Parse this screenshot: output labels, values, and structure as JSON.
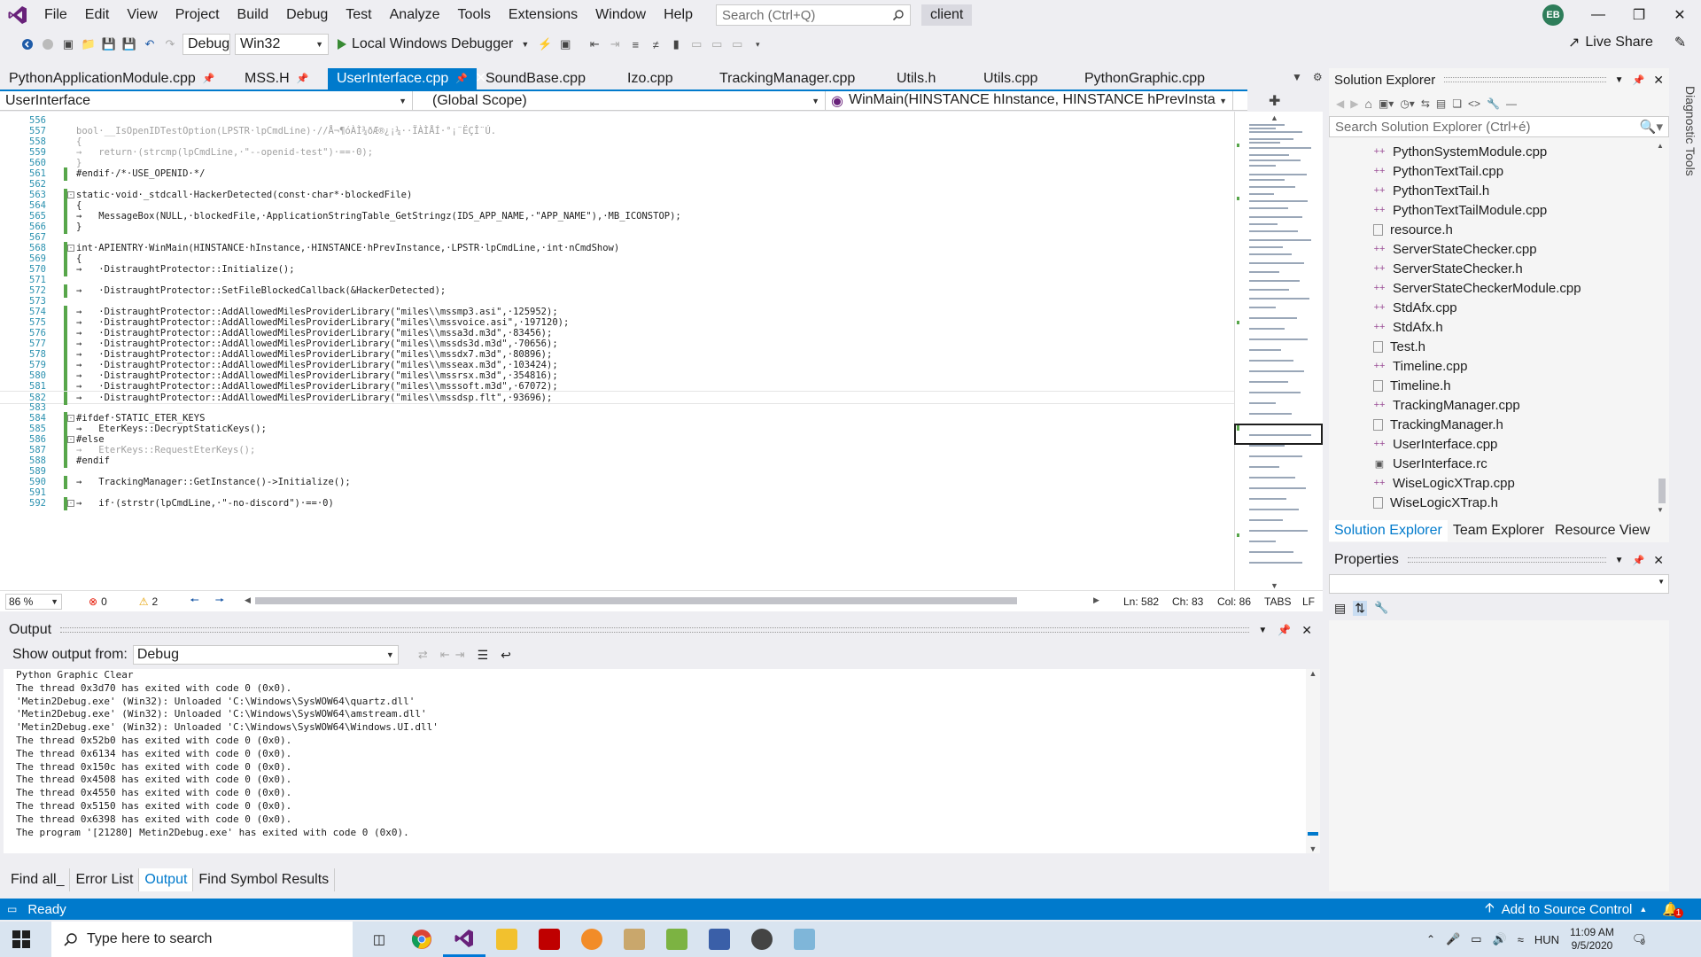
{
  "menubar": {
    "items": [
      "File",
      "Edit",
      "View",
      "Project",
      "Build",
      "Debug",
      "Test",
      "Analyze",
      "Tools",
      "Extensions",
      "Window",
      "Help"
    ],
    "search_placeholder": "Search (Ctrl+Q)",
    "solution": "client",
    "avatar_initials": "EB"
  },
  "toolbar": {
    "config": "Debug",
    "platform": "Win32",
    "debugger": "Local Windows Debugger",
    "live_share": "Live Share"
  },
  "doc_tabs": [
    {
      "label": "PythonApplicationModule.cpp",
      "pinned": true
    },
    {
      "label": "MSS.H",
      "pinned": true
    },
    {
      "label": "UserInterface.cpp",
      "pinned": true,
      "active": true
    },
    {
      "label": "SoundBase.cpp"
    },
    {
      "label": "Izo.cpp"
    },
    {
      "label": "TrackingManager.cpp"
    },
    {
      "label": "Utils.h"
    },
    {
      "label": "Utils.cpp"
    },
    {
      "label": "PythonGraphic.cpp"
    }
  ],
  "navbar": {
    "project": "UserInterface",
    "scope": "(Global Scope)",
    "member": "WinMain(HINSTANCE hInstance, HINSTANCE hPrevInstance, LPST"
  },
  "editor": {
    "lines": [
      {
        "n": "556",
        "t": ""
      },
      {
        "n": "557",
        "t": "bool·__IsOpenIDTestOption(LPSTR·lpCmdLine)·//Å¬¶óÀÌ¾ðÆ®¿¡¼­··ÏÀÌÅÍ·°¡¨ËÇÎ¨Ú.",
        "g": true
      },
      {
        "n": "558",
        "t": "{",
        "g": true
      },
      {
        "n": "559",
        "t": "→   return·(strcmp(lpCmdLine,·\"--openid-test\")·==·0);",
        "g": true
      },
      {
        "n": "560",
        "t": "}",
        "g": true
      },
      {
        "n": "561",
        "t": "#endif·/*·USE_OPENID·*/"
      },
      {
        "n": "562",
        "t": ""
      },
      {
        "n": "563",
        "t": "static·void·_stdcall·HackerDetected(const·char*·blockedFile)"
      },
      {
        "n": "564",
        "t": "{"
      },
      {
        "n": "565",
        "t": "→   MessageBox(NULL,·blockedFile,·ApplicationStringTable_GetStringz(IDS_APP_NAME,·\"APP_NAME\"),·MB_ICONSTOP);"
      },
      {
        "n": "566",
        "t": "}"
      },
      {
        "n": "567",
        "t": ""
      },
      {
        "n": "568",
        "t": "int·APIENTRY·WinMain(HINSTANCE·hInstance,·HINSTANCE·hPrevInstance,·LPSTR·lpCmdLine,·int·nCmdShow)"
      },
      {
        "n": "569",
        "t": "{"
      },
      {
        "n": "570",
        "t": "→   ·DistraughtProtector::Initialize();"
      },
      {
        "n": "571",
        "t": ""
      },
      {
        "n": "572",
        "t": "→   ·DistraughtProtector::SetFileBlockedCallback(&HackerDetected);"
      },
      {
        "n": "573",
        "t": ""
      },
      {
        "n": "574",
        "t": "→   ·DistraughtProtector::AddAllowedMilesProviderLibrary(\"miles\\\\mssmp3.asi\",·125952);"
      },
      {
        "n": "575",
        "t": "→   ·DistraughtProtector::AddAllowedMilesProviderLibrary(\"miles\\\\mssvoice.asi\",·197120);"
      },
      {
        "n": "576",
        "t": "→   ·DistraughtProtector::AddAllowedMilesProviderLibrary(\"miles\\\\mssa3d.m3d\",·83456);"
      },
      {
        "n": "577",
        "t": "→   ·DistraughtProtector::AddAllowedMilesProviderLibrary(\"miles\\\\mssds3d.m3d\",·70656);"
      },
      {
        "n": "578",
        "t": "→   ·DistraughtProtector::AddAllowedMilesProviderLibrary(\"miles\\\\mssdx7.m3d\",·80896);"
      },
      {
        "n": "579",
        "t": "→   ·DistraughtProtector::AddAllowedMilesProviderLibrary(\"miles\\\\msseax.m3d\",·103424);"
      },
      {
        "n": "580",
        "t": "→   ·DistraughtProtector::AddAllowedMilesProviderLibrary(\"miles\\\\mssrsx.m3d\",·354816);"
      },
      {
        "n": "581",
        "t": "→   ·DistraughtProtector::AddAllowedMilesProviderLibrary(\"miles\\\\msssoft.m3d\",·67072);"
      },
      {
        "n": "582",
        "t": "→   ·DistraughtProtector::AddAllowedMilesProviderLibrary(\"miles\\\\mssdsp.flt\",·93696);",
        "cur": true
      },
      {
        "n": "583",
        "t": ""
      },
      {
        "n": "584",
        "t": "#ifdef·STATIC_ETER_KEYS"
      },
      {
        "n": "585",
        "t": "→   EterKeys::DecryptStaticKeys();"
      },
      {
        "n": "586",
        "t": "#else"
      },
      {
        "n": "587",
        "t": "→   EterKeys::RequestEterKeys();",
        "g": true
      },
      {
        "n": "588",
        "t": "#endif"
      },
      {
        "n": "589",
        "t": ""
      },
      {
        "n": "590",
        "t": "→   TrackingManager::GetInstance()->Initialize();"
      },
      {
        "n": "591",
        "t": ""
      },
      {
        "n": "592",
        "t": "→   if·(strstr(lpCmdLine,·\"-no-discord\")·==·0)"
      }
    ]
  },
  "ed_status": {
    "zoom": "86 %",
    "errors": "0",
    "warnings": "2",
    "ln": "Ln: 582",
    "ch": "Ch: 83",
    "col": "Col: 86",
    "tabs": "TABS",
    "eol": "LF"
  },
  "output": {
    "title": "Output",
    "show_from_label": "Show output from:",
    "source": "Debug",
    "lines": [
      "Python Graphic Clear",
      "The thread 0x3d70 has exited with code 0 (0x0).",
      "'Metin2Debug.exe' (Win32): Unloaded 'C:\\Windows\\SysWOW64\\quartz.dll'",
      "'Metin2Debug.exe' (Win32): Unloaded 'C:\\Windows\\SysWOW64\\amstream.dll'",
      "'Metin2Debug.exe' (Win32): Unloaded 'C:\\Windows\\SysWOW64\\Windows.UI.dll'",
      "The thread 0x52b0 has exited with code 0 (0x0).",
      "The thread 0x6134 has exited with code 0 (0x0).",
      "The thread 0x150c has exited with code 0 (0x0).",
      "The thread 0x4508 has exited with code 0 (0x0).",
      "The thread 0x4550 has exited with code 0 (0x0).",
      "The thread 0x5150 has exited with code 0 (0x0).",
      "The thread 0x6398 has exited with code 0 (0x0).",
      "The program '[21280] Metin2Debug.exe' has exited with code 0 (0x0)."
    ]
  },
  "bottom_tabs": [
    "Find all_",
    "Error List",
    "Output",
    "Find Symbol Results"
  ],
  "solution_explorer": {
    "title": "Solution Explorer",
    "search_placeholder": "Search Solution Explorer (Ctrl+é)",
    "files": [
      {
        "name": "PythonSystemModule.cpp",
        "kind": "cpp"
      },
      {
        "name": "PythonTextTail.cpp",
        "kind": "cpp"
      },
      {
        "name": "PythonTextTail.h",
        "kind": "cpp"
      },
      {
        "name": "PythonTextTailModule.cpp",
        "kind": "cpp"
      },
      {
        "name": "resource.h",
        "kind": "h"
      },
      {
        "name": "ServerStateChecker.cpp",
        "kind": "cpp"
      },
      {
        "name": "ServerStateChecker.h",
        "kind": "cpp"
      },
      {
        "name": "ServerStateCheckerModule.cpp",
        "kind": "cpp"
      },
      {
        "name": "StdAfx.cpp",
        "kind": "cpp"
      },
      {
        "name": "StdAfx.h",
        "kind": "cpp"
      },
      {
        "name": "Test.h",
        "kind": "h"
      },
      {
        "name": "Timeline.cpp",
        "kind": "cpp"
      },
      {
        "name": "Timeline.h",
        "kind": "h"
      },
      {
        "name": "TrackingManager.cpp",
        "kind": "cpp"
      },
      {
        "name": "TrackingManager.h",
        "kind": "h"
      },
      {
        "name": "UserInterface.cpp",
        "kind": "cpp"
      },
      {
        "name": "UserInterface.rc",
        "kind": "rc"
      },
      {
        "name": "WiseLogicXTrap.cpp",
        "kind": "cpp"
      },
      {
        "name": "WiseLogicXTrap.h",
        "kind": "h"
      }
    ],
    "tabs": [
      "Solution Explorer",
      "Team Explorer",
      "Resource View"
    ]
  },
  "properties": {
    "title": "Properties"
  },
  "diagnostic_tools": "Diagnostic Tools",
  "statusbar": {
    "ready": "Ready",
    "source_control": "Add to Source Control",
    "notifications": "1"
  },
  "taskbar": {
    "search_placeholder": "Type here to search",
    "lang": "HUN",
    "time": "11:09 AM",
    "date": "9/5/2020",
    "notif_count": "9"
  },
  "colors": {
    "accent": "#007acc",
    "line_numbers": "#2b91af",
    "change_bar": "#57a64a"
  }
}
